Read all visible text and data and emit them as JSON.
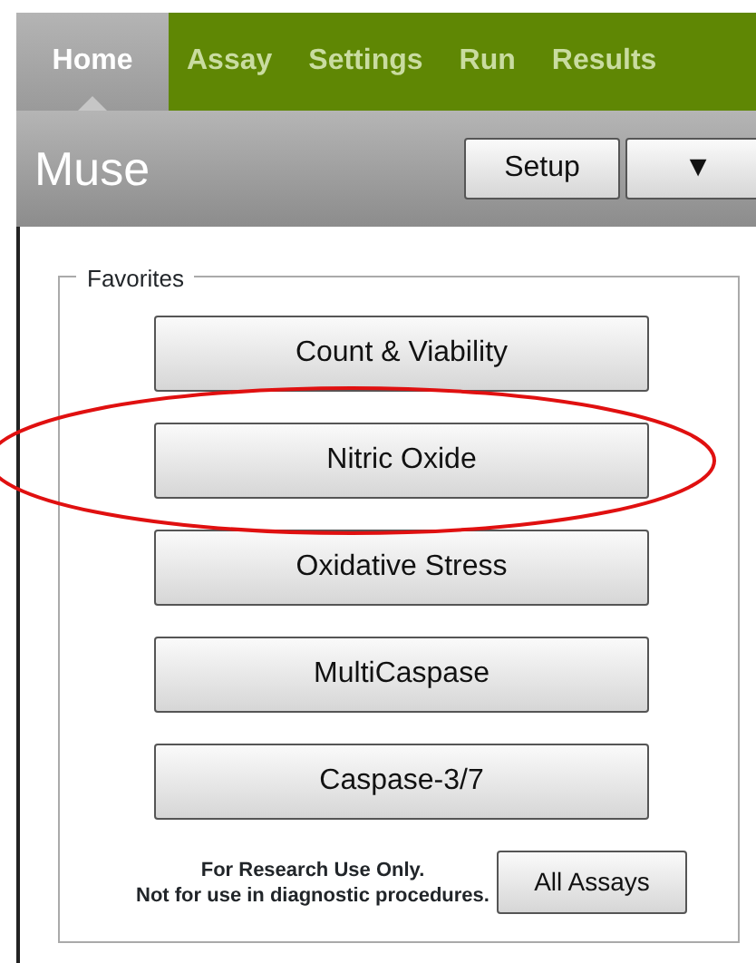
{
  "tabs": [
    {
      "label": "Home",
      "selected": true
    },
    {
      "label": "Assay",
      "selected": false
    },
    {
      "label": "Settings",
      "selected": false
    },
    {
      "label": "Run",
      "selected": false
    },
    {
      "label": "Results",
      "selected": false
    }
  ],
  "header": {
    "title": "Muse",
    "setup_button": "Setup",
    "menu_button": "▼"
  },
  "favorites": {
    "legend": "Favorites",
    "items": [
      {
        "label": "Count & Viability",
        "circled": false
      },
      {
        "label": "Nitric Oxide",
        "circled": true
      },
      {
        "label": "Oxidative Stress",
        "circled": false
      },
      {
        "label": "MultiCaspase",
        "circled": false
      },
      {
        "label": "Caspase-3/7",
        "circled": false
      }
    ],
    "notice": [
      "For Research Use Only.",
      "Not for use in diagnostic procedures."
    ],
    "all_button": "All Assays"
  }
}
